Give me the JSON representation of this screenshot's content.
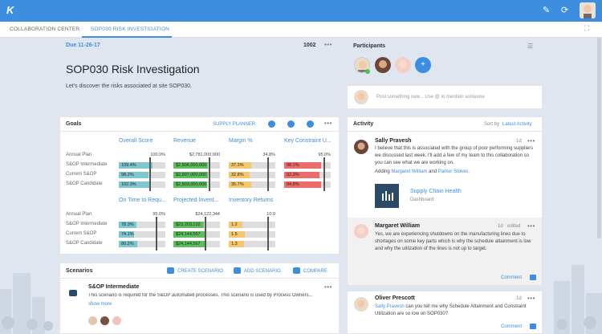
{
  "topbar": {
    "logo_text": "K",
    "edit_icon": "pencil-icon",
    "share_icon": "share-icon"
  },
  "tabs": [
    {
      "label": "COLLABORATION CENTER"
    },
    {
      "label": "SOP030 RISK INVESTIGATION"
    }
  ],
  "header": {
    "due": "Due 11-26-17",
    "id": "1002",
    "title": "SOP030 Risk Investigation",
    "description": "Let's discover the risks associated at site SOP030."
  },
  "goals": {
    "title": "Goals",
    "supply_planner": "SUPPLY PLANNER",
    "row_labels": [
      "Annual Plan",
      "S&OP Intermediate",
      "Current S&OP",
      "S&OP Candidate"
    ],
    "metrics_top": [
      {
        "name": "Overall Score",
        "plan": "100.0%",
        "values": [
          "109.4%",
          "98.2%",
          "102.3%"
        ],
        "fills": [
          0.72,
          0.64,
          0.67
        ],
        "marker": 0.66,
        "color": "#7fc7cf"
      },
      {
        "name": "Revenue",
        "plan": "$2,781,000,000",
        "values": [
          "$2,806,000,000",
          "$2,807,000,000",
          "$2,803,000,000"
        ],
        "fills": [
          0.74,
          0.74,
          0.73
        ],
        "marker": 0.75,
        "color": "#5ebe5e"
      },
      {
        "name": "Margin %",
        "plan": "34.8%",
        "values": [
          "37.3%",
          "32.8%",
          "35.7%"
        ],
        "fills": [
          0.48,
          0.45,
          0.49
        ],
        "marker": 0.82,
        "color": "#f5c86f"
      },
      {
        "name": "Key Constraint U...",
        "plan": "95.0%",
        "values": [
          "98.1%",
          "92.3%",
          "94.8%"
        ],
        "fills": [
          0.8,
          0.76,
          0.8
        ],
        "marker": 0.85,
        "color": "#ec6b6b"
      }
    ],
    "metrics_bottom": [
      {
        "name": "On Time to Requ...",
        "plan": "95.0%",
        "values": [
          "78.3%",
          "74.1%",
          "80.2%"
        ],
        "fills": [
          0.38,
          0.33,
          0.4
        ],
        "marker": 0.8,
        "color": "#7fc7cf"
      },
      {
        "name": "Projected Invent...",
        "plan": "$24,122,344",
        "values": [
          "$23,203,132",
          "$24,144,567",
          "$24,144,567"
        ],
        "fills": [
          0.66,
          0.7,
          0.7
        ],
        "marker": 0.68,
        "color": "#5ebe5e"
      },
      {
        "name": "Inventory Returns",
        "plan": "10.9",
        "values": [
          "1.2",
          "1.5",
          "1.3"
        ],
        "fills": [
          0.3,
          0.35,
          0.32
        ],
        "marker": 0.82,
        "color": "#f5c86f"
      }
    ]
  },
  "scenarios": {
    "title": "Scenarios",
    "create": "CREATE SCENARIO",
    "add": "ADD SCENARIO",
    "compare": "COMPARE",
    "item_title": "S&OP Intermediate",
    "item_desc": "This scenario is required for the S&OP automated processes. This scenario is used by Process Owners...",
    "show_more": "show more"
  },
  "participants": {
    "title": "Participants"
  },
  "post": {
    "placeholder": "Post something new... Use @ to mention someone"
  },
  "activity": {
    "title": "Activity",
    "sort_label": "Sort by",
    "sort_value": "Latest Activity",
    "items": [
      {
        "name": "Sally Pravesh",
        "time": "1d",
        "text": "I believe that this is associated with the group of poor performing suppliers we discussed last week. I'll add a few of my team to this collaboration so you can see what we are working on.",
        "adding": "Adding",
        "user1": "Margaret William",
        "and": "and",
        "user2": "Parker Stokes.",
        "attachment_title": "Supply Chain Health",
        "attachment_sub": "Dashboard"
      },
      {
        "name": "Margaret William",
        "time": "1d",
        "edited": "edited",
        "text": "Yes, we are experiencing shutdowns on the manufacturing lines due to shortages on some key parts which is why the schedule attainment is low and why the utilization of the lines is not up to target.",
        "comment": "Comment"
      },
      {
        "name": "Oliver Prescott",
        "time": "1d",
        "mention": "Sally Pravesh",
        "text": "can you tell me why Schedule Attainment and Constraint Utilization are so low on SOP030?",
        "comment": "Comment"
      }
    ]
  },
  "colors": {
    "accent": "#3d8ee0",
    "teal": "#7fc7cf",
    "green": "#5ebe5e",
    "amber": "#f5c86f",
    "red": "#ec6b6b"
  }
}
